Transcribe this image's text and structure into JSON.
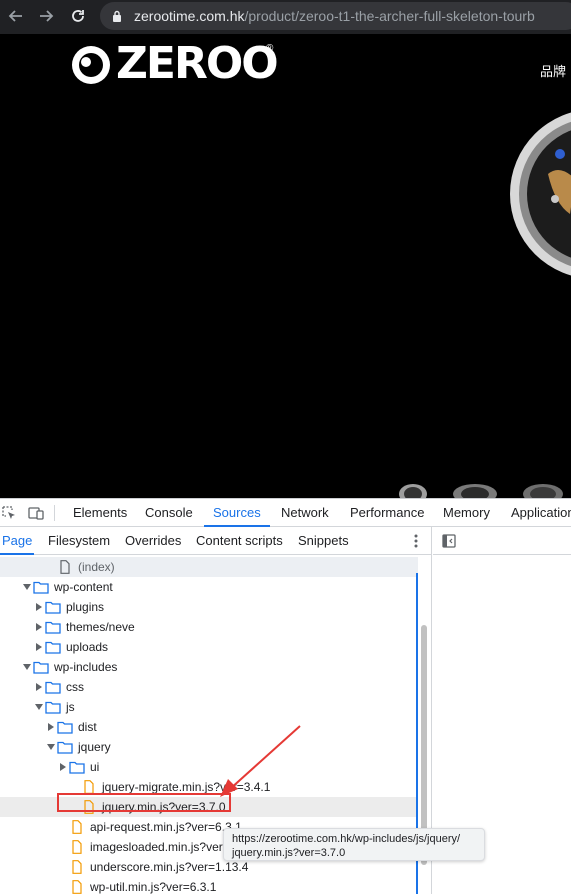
{
  "browser": {
    "url_domain": "zerootime.com.hk",
    "url_path": "/product/zeroo-t1-the-archer-full-skeleton-tourb",
    "back_icon": "arrow-left-icon",
    "forward_icon": "arrow-right-icon",
    "reload_icon": "reload-icon",
    "lock_icon": "lock-icon"
  },
  "page": {
    "logo_text": "ZEROO",
    "logo_reg": "®",
    "nav_brand": "品牌",
    "background_color": "#000000"
  },
  "devtools": {
    "tabs": [
      {
        "label": "Elements",
        "active": false
      },
      {
        "label": "Console",
        "active": false
      },
      {
        "label": "Sources",
        "active": true
      },
      {
        "label": "Network",
        "active": false
      },
      {
        "label": "Performance",
        "active": false
      },
      {
        "label": "Memory",
        "active": false
      },
      {
        "label": "Application",
        "active": false
      }
    ],
    "sub_tabs": [
      {
        "label": "Page",
        "active": true
      },
      {
        "label": "Filesystem",
        "active": false
      },
      {
        "label": "Overrides",
        "active": false
      },
      {
        "label": "Content scripts",
        "active": false
      },
      {
        "label": "Snippets",
        "active": false
      }
    ],
    "tree": [
      {
        "label": "(index)",
        "type": "file-gray",
        "depth": 3,
        "expanded": null
      },
      {
        "label": "wp-content",
        "type": "folder",
        "depth": 1,
        "expanded": true
      },
      {
        "label": "plugins",
        "type": "folder",
        "depth": 2,
        "expanded": false
      },
      {
        "label": "themes/neve",
        "type": "folder",
        "depth": 2,
        "expanded": false
      },
      {
        "label": "uploads",
        "type": "folder",
        "depth": 2,
        "expanded": false
      },
      {
        "label": "wp-includes",
        "type": "folder",
        "depth": 1,
        "expanded": true
      },
      {
        "label": "css",
        "type": "folder",
        "depth": 2,
        "expanded": false
      },
      {
        "label": "js",
        "type": "folder",
        "depth": 2,
        "expanded": true
      },
      {
        "label": "dist",
        "type": "folder",
        "depth": 3,
        "expanded": false
      },
      {
        "label": "jquery",
        "type": "folder",
        "depth": 3,
        "expanded": true
      },
      {
        "label": "ui",
        "type": "folder",
        "depth": 4,
        "expanded": false
      },
      {
        "label": "jquery-migrate.min.js?ver=3.4.1",
        "type": "file",
        "depth": 5,
        "expanded": null
      },
      {
        "label": "jquery.min.js?ver=3.7.0",
        "type": "file",
        "depth": 5,
        "expanded": null
      },
      {
        "label": "api-request.min.js?ver=6.3.1",
        "type": "file",
        "depth": 4,
        "expanded": null
      },
      {
        "label": "imagesloaded.min.js?ver=5.0.0",
        "type": "file",
        "depth": 4,
        "expanded": null
      },
      {
        "label": "underscore.min.js?ver=1.13.4",
        "type": "file",
        "depth": 4,
        "expanded": null
      },
      {
        "label": "wp-util.min.js?ver=6.3.1",
        "type": "file",
        "depth": 4,
        "expanded": null
      }
    ],
    "tooltip": {
      "line1": "https://zerootime.com.hk/wp-includes/js/jquery/",
      "line2": "jquery.min.js?ver=3.7.0"
    },
    "accent_color": "#1a73e8",
    "folder_color": "#1a73e8",
    "file_color": "#f29900",
    "annotation_color": "#e53935"
  }
}
